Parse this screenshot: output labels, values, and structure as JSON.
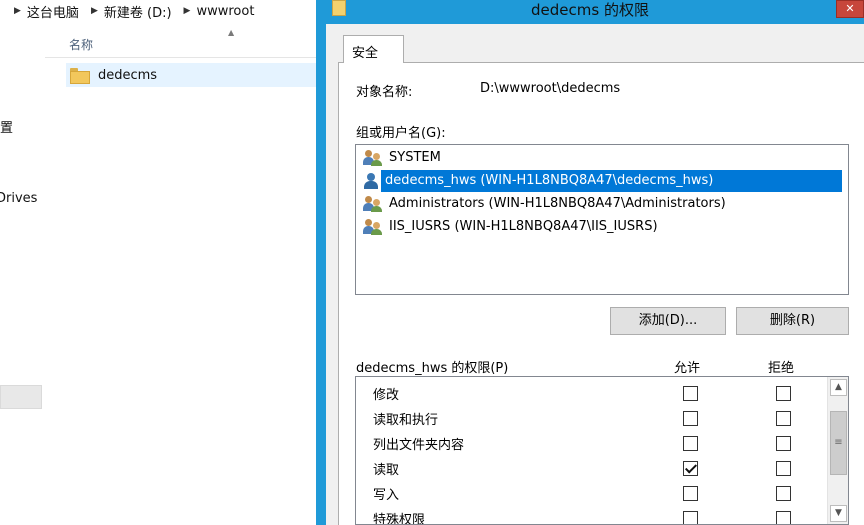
{
  "explorer": {
    "breadcrumb": [
      "这台电脑",
      "新建卷 (D:)",
      "wwwroot"
    ],
    "column_name": "名称",
    "files": [
      {
        "name": "dedecms"
      }
    ],
    "nav_labels": [
      "置",
      "Drives"
    ]
  },
  "dialog": {
    "title": "dedecms 的权限",
    "close_glyph": "✕",
    "tab_label": "安全",
    "object_label": "对象名称:",
    "object_value": "D:\\wwwroot\\dedecms",
    "group_label": "组或用户名(G):",
    "users": [
      {
        "name": "SYSTEM",
        "icon": "group-icon"
      },
      {
        "name": "dedecms_hws (WIN-H1L8NBQ8A47\\dedecms_hws)",
        "icon": "user-icon",
        "selected": true
      },
      {
        "name": "Administrators (WIN-H1L8NBQ8A47\\Administrators)",
        "icon": "group-icon"
      },
      {
        "name": "IIS_IUSRS (WIN-H1L8NBQ8A47\\IIS_IUSRS)",
        "icon": "group-icon"
      }
    ],
    "add_button": "添加(D)...",
    "remove_button": "删除(R)",
    "permissions_label": "dedecms_hws 的权限(P)",
    "allow_header": "允许",
    "deny_header": "拒绝",
    "permissions": [
      {
        "name": "修改",
        "allow": false,
        "deny": false
      },
      {
        "name": "读取和执行",
        "allow": false,
        "deny": false
      },
      {
        "name": "列出文件夹内容",
        "allow": false,
        "deny": false
      },
      {
        "name": "读取",
        "allow": true,
        "deny": false
      },
      {
        "name": "写入",
        "allow": false,
        "deny": false
      },
      {
        "name": "特殊权限",
        "allow": false,
        "deny": false
      }
    ],
    "accent_color": "#1f9ad8",
    "selection_color": "#0078d7"
  }
}
